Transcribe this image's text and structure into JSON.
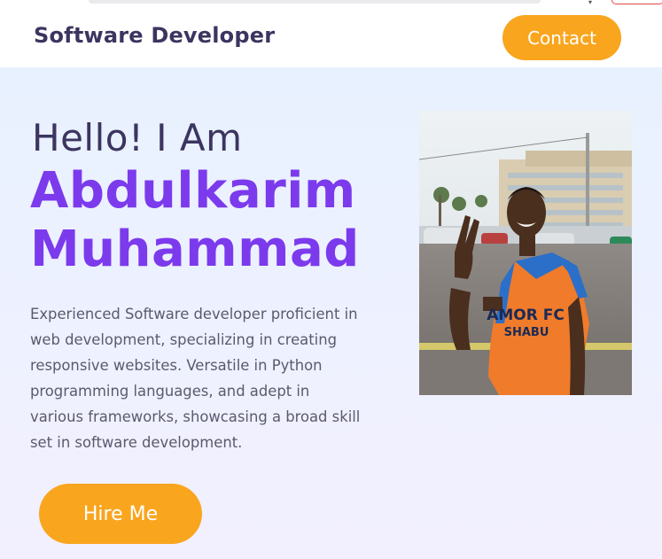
{
  "header": {
    "brand": "Software Developer",
    "contact_label": "Contact"
  },
  "hero": {
    "greeting": "Hello! I Am",
    "name_first": "Abdulkarim",
    "name_last": "Muhammad",
    "bio": "Experienced Software developer proficient in web development, specializing in creating responsive websites. Versatile in Python programming languages, and adept in various frameworks, showcasing a broad skill set in software development.",
    "hire_label": "Hire Me",
    "photo": {
      "jersey_line1": "AMOR FC",
      "jersey_line2": "SHABU"
    }
  },
  "colors": {
    "accent": "#f9a51e",
    "name": "#7c3aed",
    "heading": "#3b3560",
    "body_text": "#5a5a6e",
    "hero_bg": "#eaf1ff"
  }
}
